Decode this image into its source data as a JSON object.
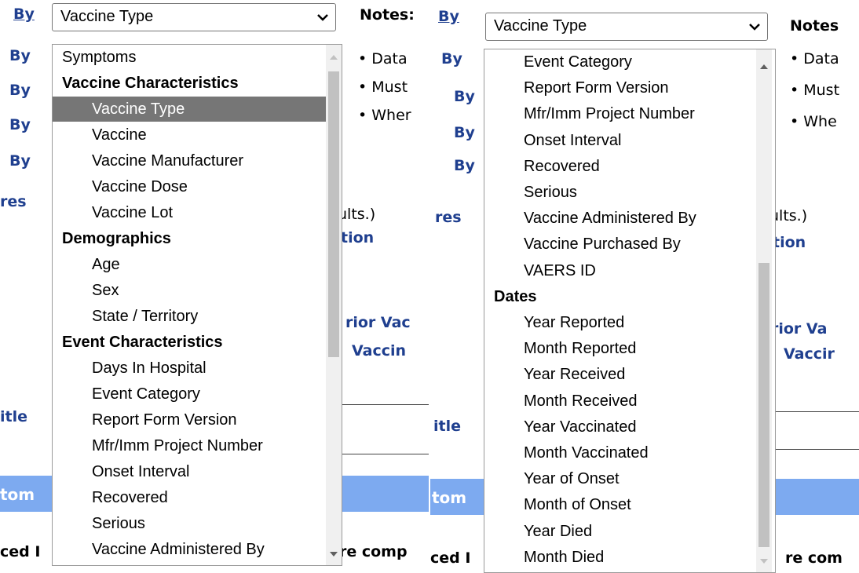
{
  "left": {
    "by_links": [
      "By",
      "By",
      "By",
      "By",
      "By"
    ],
    "select_value": "Vaccine Type",
    "notes_title": "Notes:",
    "notes": [
      "• Data",
      "• Must",
      "• Wher"
    ],
    "partial": {
      "res": "res",
      "ults": "ults.)",
      "tion": "tion",
      "rior_vac": "rior Vac",
      "vaccin": "Vaccin",
      "itle": "itle",
      "toms": "tom",
      "ced": "ced I",
      "re_comp": "re comp"
    },
    "dropdown": {
      "options": [
        {
          "label": "Symptoms",
          "kind": "top"
        },
        {
          "label": "Vaccine Characteristics",
          "kind": "group"
        },
        {
          "label": "Vaccine Type",
          "kind": "selected"
        },
        {
          "label": "Vaccine",
          "kind": "item"
        },
        {
          "label": "Vaccine Manufacturer",
          "kind": "item"
        },
        {
          "label": "Vaccine Dose",
          "kind": "item"
        },
        {
          "label": "Vaccine Lot",
          "kind": "item"
        },
        {
          "label": "Demographics",
          "kind": "group"
        },
        {
          "label": "Age",
          "kind": "item"
        },
        {
          "label": "Sex",
          "kind": "item"
        },
        {
          "label": "State / Territory",
          "kind": "item"
        },
        {
          "label": "Event Characteristics",
          "kind": "group"
        },
        {
          "label": "Days In Hospital",
          "kind": "item"
        },
        {
          "label": "Event Category",
          "kind": "item"
        },
        {
          "label": "Report Form Version",
          "kind": "item"
        },
        {
          "label": "Mfr/Imm Project Number",
          "kind": "item"
        },
        {
          "label": "Onset Interval",
          "kind": "item"
        },
        {
          "label": "Recovered",
          "kind": "item"
        },
        {
          "label": "Serious",
          "kind": "item"
        },
        {
          "label": "Vaccine Administered By",
          "kind": "item"
        }
      ]
    }
  },
  "right": {
    "by_links": [
      "By",
      "By",
      "By",
      "By",
      "By"
    ],
    "select_value": "Vaccine Type",
    "notes_title": "Notes",
    "notes": [
      "• Data",
      "• Must",
      "• Whe"
    ],
    "partial": {
      "res": "res",
      "ults": "ults.)",
      "tion": "tion",
      "rior_va": "rior Va",
      "vaccir": "Vaccir",
      "itle": "itle",
      "tom": "tom",
      "ced": "ced I",
      "re_com": "re com"
    },
    "dropdown": {
      "options": [
        {
          "label": "Event Category",
          "kind": "item"
        },
        {
          "label": "Report Form Version",
          "kind": "item"
        },
        {
          "label": "Mfr/Imm Project Number",
          "kind": "item"
        },
        {
          "label": "Onset Interval",
          "kind": "item"
        },
        {
          "label": "Recovered",
          "kind": "item"
        },
        {
          "label": "Serious",
          "kind": "item"
        },
        {
          "label": "Vaccine Administered By",
          "kind": "item"
        },
        {
          "label": "Vaccine Purchased By",
          "kind": "item"
        },
        {
          "label": "VAERS ID",
          "kind": "item"
        },
        {
          "label": "Dates",
          "kind": "group"
        },
        {
          "label": "Year Reported",
          "kind": "item"
        },
        {
          "label": "Month Reported",
          "kind": "item"
        },
        {
          "label": "Year Received",
          "kind": "item"
        },
        {
          "label": "Month Received",
          "kind": "item"
        },
        {
          "label": "Year Vaccinated",
          "kind": "item"
        },
        {
          "label": "Month Vaccinated",
          "kind": "item"
        },
        {
          "label": "Year of Onset",
          "kind": "item"
        },
        {
          "label": "Month of Onset",
          "kind": "item"
        },
        {
          "label": "Year Died",
          "kind": "item"
        },
        {
          "label": "Month Died",
          "kind": "item"
        }
      ]
    }
  },
  "colors": {
    "link_blue": "#1f3f8f",
    "band_blue": "#7daaf0",
    "selected_bg": "#767676",
    "scroll_thumb": "#c1c1c1"
  }
}
